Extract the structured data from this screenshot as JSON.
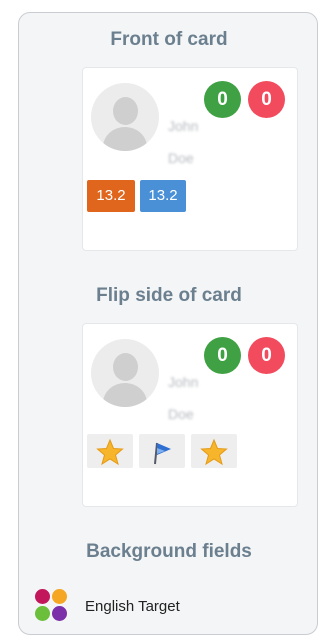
{
  "front": {
    "title": "Front of card",
    "name_line1": "John",
    "name_line2": "Doe",
    "count_green": "0",
    "count_red": "0",
    "tags": [
      "13.2",
      "13.2"
    ]
  },
  "flip": {
    "title": "Flip side of card",
    "name_line1": "John",
    "name_line2": "Doe",
    "count_green": "0",
    "count_red": "0",
    "icons": [
      "star-icon",
      "flag-icon",
      "star-icon"
    ]
  },
  "background": {
    "title": "Background fields",
    "item_label": "English Target",
    "dot_colors": [
      "#c2185b",
      "#f5a623",
      "#6bbf3a",
      "#7b2fa8"
    ]
  },
  "colors": {
    "green": "#3fa144",
    "red": "#f24b5e",
    "orange_tag": "#e0661e",
    "blue_tag": "#4a90d6",
    "title": "#6b7f8e"
  }
}
